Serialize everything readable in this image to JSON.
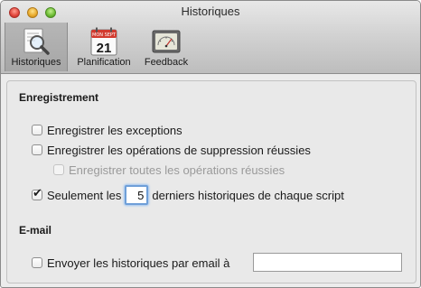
{
  "window": {
    "title": "Historiques"
  },
  "toolbar": {
    "items": [
      {
        "label": "Historiques",
        "icon": "log-magnifier-icon",
        "selected": true
      },
      {
        "label": "Planification",
        "icon": "calendar-icon",
        "selected": false
      },
      {
        "label": "Feedback",
        "icon": "gauge-meter-icon",
        "selected": false
      }
    ],
    "calendar_header": "MON SEPT",
    "calendar_day": "21"
  },
  "recording": {
    "title": "Enregistrement",
    "exceptions_label": "Enregistrer les exceptions",
    "exceptions_checked": false,
    "deletions_label": "Enregistrer les opérations de suppression réussies",
    "deletions_checked": false,
    "all_ops_label": "Enregistrer toutes les opérations réussies",
    "all_ops_checked": false,
    "all_ops_enabled": false,
    "only_last_prefix": "Seulement les",
    "only_last_checked": true,
    "only_last_count": "5",
    "only_last_suffix": "derniers historiques de chaque script"
  },
  "email": {
    "title": "E-mail",
    "send_label": "Envoyer les historiques par email à",
    "send_checked": false,
    "address_value": ""
  }
}
